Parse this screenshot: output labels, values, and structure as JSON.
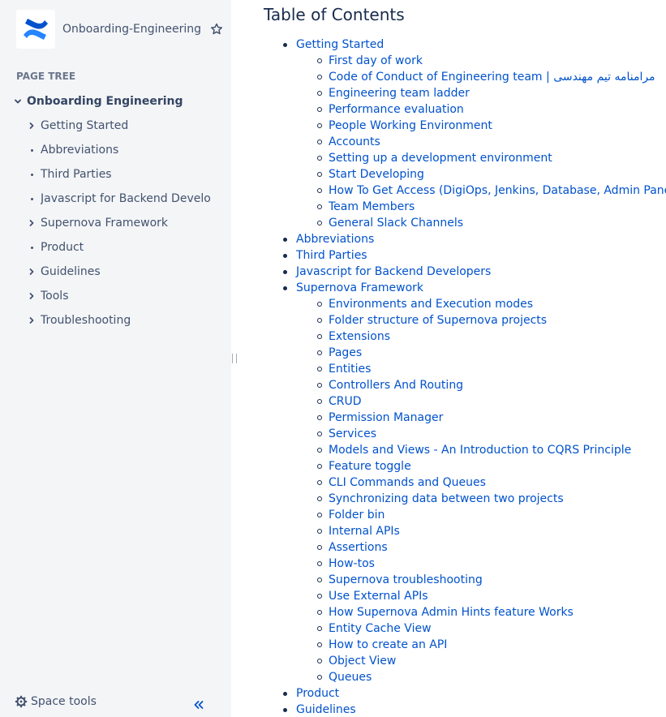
{
  "sidebar": {
    "space_name": "Onboarding-Engineering",
    "page_tree_heading": "PAGE TREE",
    "root": {
      "label": "Onboarding Engineering",
      "expanded": true
    },
    "items": [
      {
        "label": "Getting Started",
        "has_children": true
      },
      {
        "label": "Abbreviations",
        "has_children": false
      },
      {
        "label": "Third Parties",
        "has_children": false
      },
      {
        "label": "Javascript for Backend Developers",
        "has_children": false
      },
      {
        "label": "Supernova Framework",
        "has_children": true
      },
      {
        "label": "Product",
        "has_children": false
      },
      {
        "label": "Guidelines",
        "has_children": true
      },
      {
        "label": "Tools",
        "has_children": true
      },
      {
        "label": "Troubleshooting",
        "has_children": true
      }
    ],
    "space_tools_label": "Space tools",
    "icons": {
      "logo": "confluence-logo-icon",
      "star": "star-icon",
      "gear": "gear-icon",
      "collapse": "double-chevron-left-icon"
    }
  },
  "main": {
    "toc_title": "Table of Contents",
    "toc": [
      {
        "label": "Getting Started",
        "children": [
          "First day of work",
          "Code of Conduct of Engineering team | مرامنامه تیم مهندسی",
          "Engineering team ladder",
          "Performance evaluation",
          "People Working Environment",
          "Accounts",
          "Setting up a development environment",
          "Start Developing",
          "How To Get Access (DigiOps, Jenkins, Database, Admin Panel)",
          "Team Members",
          "General Slack Channels"
        ]
      },
      {
        "label": "Abbreviations",
        "children": []
      },
      {
        "label": "Third Parties",
        "children": []
      },
      {
        "label": "Javascript for Backend Developers",
        "children": []
      },
      {
        "label": "Supernova Framework",
        "children": [
          "Environments and Execution modes",
          "Folder structure of Supernova projects",
          "Extensions",
          "Pages",
          "Entities",
          "Controllers And Routing",
          "CRUD",
          "Permission Manager",
          "Services",
          "Models and Views - An Introduction to CQRS Principle",
          "Feature toggle",
          "CLI Commands and Queues",
          "Synchronizing data between two projects",
          "Folder bin",
          "Internal APIs",
          "Assertions",
          "How-tos",
          "Supernova troubleshooting",
          "Use External APIs",
          "How Supernova Admin Hints feature Works",
          "Entity Cache View",
          "How to create an API",
          "Object View",
          "Queues"
        ]
      },
      {
        "label": "Product",
        "children": []
      },
      {
        "label": "Guidelines",
        "children": []
      }
    ]
  },
  "colors": {
    "sidebar_bg": "#f4f5f7",
    "link": "#0052cc",
    "text": "#172b4d",
    "muted": "#42526e",
    "brand": "#2684ff"
  }
}
